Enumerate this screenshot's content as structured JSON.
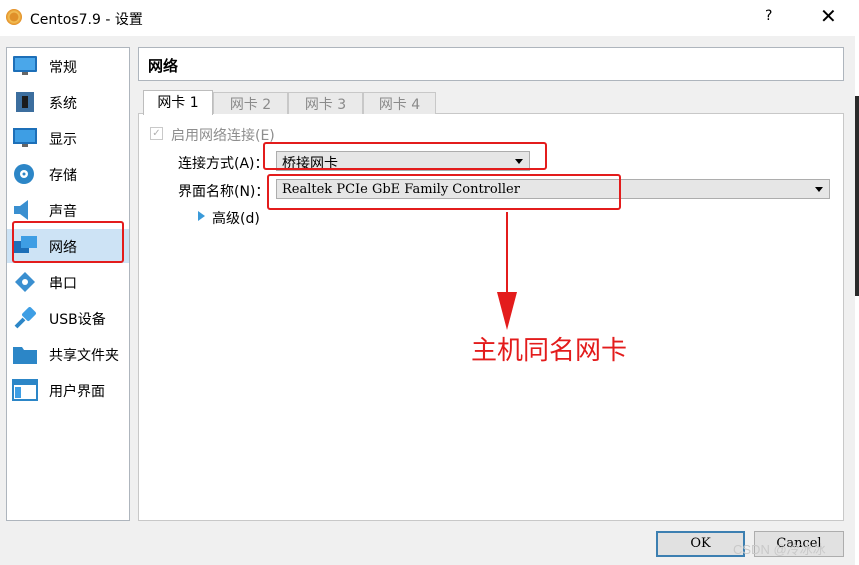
{
  "window": {
    "title": "Centos7.9 - 设置",
    "help": "?",
    "close": "✕"
  },
  "sidebar": {
    "items": [
      {
        "label": "常规",
        "icon": "monitor-icon"
      },
      {
        "label": "系统",
        "icon": "motherboard-icon"
      },
      {
        "label": "显示",
        "icon": "display-icon"
      },
      {
        "label": "存储",
        "icon": "storage-disk-icon"
      },
      {
        "label": "声音",
        "icon": "speaker-icon"
      },
      {
        "label": "网络",
        "icon": "network-icon"
      },
      {
        "label": "串口",
        "icon": "serial-port-icon"
      },
      {
        "label": "USB设备",
        "icon": "usb-icon"
      },
      {
        "label": "共享文件夹",
        "icon": "folder-icon"
      },
      {
        "label": "用户界面",
        "icon": "user-interface-icon"
      }
    ],
    "selected": "网络"
  },
  "header": {
    "title": "网络"
  },
  "tabs": [
    {
      "label": "网卡 1"
    },
    {
      "label": "网卡 2"
    },
    {
      "label": "网卡 3"
    },
    {
      "label": "网卡 4"
    }
  ],
  "adapter": {
    "enable_label": "启用网络连接(E)",
    "enabled": true,
    "attach_label": "连接方式(A)：",
    "attach_value": "桥接网卡",
    "name_label": "界面名称(N)：",
    "name_value": "Realtek PCIe GbE Family Controller",
    "advanced_label": "高级(d)"
  },
  "annotation": {
    "text": "主机同名网卡",
    "color": "#e31c1c"
  },
  "buttons": {
    "ok": "OK",
    "cancel": "Cancel"
  },
  "watermark": "CSDN @冷冰冰"
}
